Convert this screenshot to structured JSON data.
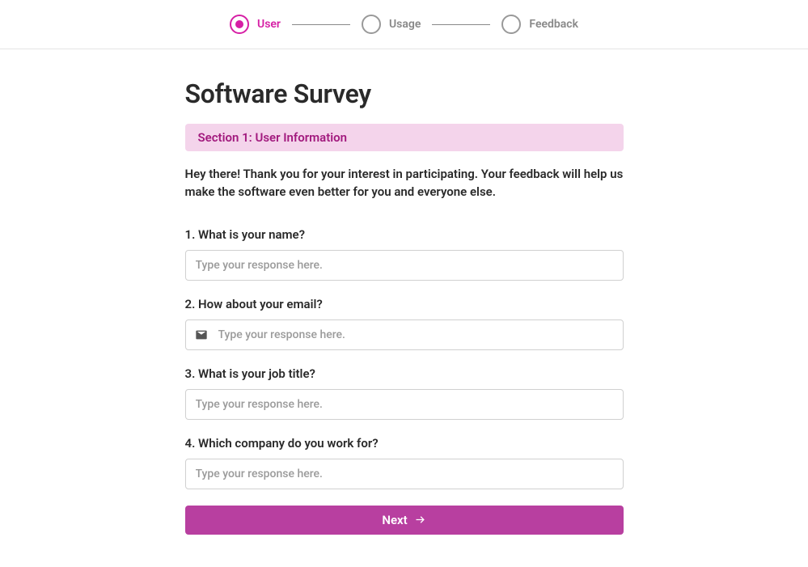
{
  "stepper": {
    "steps": [
      {
        "label": "User",
        "active": true
      },
      {
        "label": "Usage",
        "active": false
      },
      {
        "label": "Feedback",
        "active": false
      }
    ]
  },
  "page_title": "Software Survey",
  "section_banner": "Section 1: User Information",
  "intro": "Hey there! Thank you for your interest in participating. Your feedback will help us make the software even better for you and everyone else.",
  "questions": {
    "q1": {
      "label": "1. What is your name?",
      "placeholder": "Type your response here."
    },
    "q2": {
      "label": "2. How about your email?",
      "placeholder": "Type your response here."
    },
    "q3": {
      "label": "3. What is your job title?",
      "placeholder": "Type your response here."
    },
    "q4": {
      "label": "4. Which company do you work for?",
      "placeholder": "Type your response here."
    }
  },
  "next_button": "Next"
}
